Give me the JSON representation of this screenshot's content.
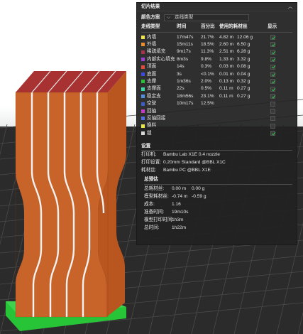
{
  "panel": {
    "title": "切片结果",
    "collapse_icon": "chevron-up-icon",
    "color_scheme": {
      "label": "颜色方案",
      "value": "走线类型"
    },
    "columns": {
      "type": "走线类型",
      "time": "时间",
      "percent": "百分比",
      "filament": "使用的耗材丝",
      "display": "显示"
    },
    "rows": [
      {
        "name": "内墙",
        "color": "#f0e548",
        "time": "17m47s",
        "percent": "21.7%",
        "length": "4.82 m",
        "weight": "12.06 g",
        "shown": true
      },
      {
        "name": "外墙",
        "color": "#f08b2c",
        "time": "15m11s",
        "percent": "18.5%",
        "length": "2.60 m",
        "weight": "6.50 g",
        "shown": true
      },
      {
        "name": "稀疏填充",
        "color": "#a8324a",
        "time": "9m17s",
        "percent": "11.3%",
        "length": "2.51 m",
        "weight": "6.28 g",
        "shown": true
      },
      {
        "name": "内部实心填充",
        "color": "#9b3fd6",
        "time": "8m3s",
        "percent": "9.8%",
        "length": "1.33 m",
        "weight": "3.32 g",
        "shown": true
      },
      {
        "name": "顶面",
        "color": "#e24a3a",
        "time": "14s",
        "percent": "0.3%",
        "length": "0.03 m",
        "weight": "0.08 g",
        "shown": true
      },
      {
        "name": "底面",
        "color": "#3c4ae0",
        "time": "3s",
        "percent": "<0.1%",
        "length": "0.01 m",
        "weight": "0.04 g",
        "shown": true
      },
      {
        "name": "支撑",
        "color": "#27c437",
        "time": "1m36s",
        "percent": "2.0%",
        "length": "0.13 m",
        "weight": "0.32 g",
        "shown": true
      },
      {
        "name": "支撑面",
        "color": "#3cd9a6",
        "time": "22s",
        "percent": "0.5%",
        "length": "0.11 m",
        "weight": "0.27 g",
        "shown": true
      },
      {
        "name": "稳定支",
        "color": "#4f8fe0",
        "time": "18m56s",
        "percent": "23.1%",
        "length": "0.11 m",
        "weight": "0.27 g",
        "shown": true
      },
      {
        "name": "空驶",
        "color": "#3b5fc4",
        "time": "10m17s",
        "percent": "12.5%",
        "length": "",
        "weight": "",
        "shown": false
      },
      {
        "name": "回抽",
        "color": "#c43cc4",
        "time": "",
        "percent": "",
        "length": "",
        "weight": "",
        "shown": false
      },
      {
        "name": "反抽回接",
        "color": "#4f6fe0",
        "time": "",
        "percent": "",
        "length": "",
        "weight": "",
        "shown": false
      },
      {
        "name": "换料",
        "color": "#e8e84a",
        "time": "",
        "percent": "",
        "length": "",
        "weight": "",
        "shown": false
      },
      {
        "name": "缝",
        "color": "#d8d8d8",
        "time": "",
        "percent": "",
        "length": "",
        "weight": "",
        "shown": true
      }
    ],
    "settings": {
      "title": "设置",
      "printer": {
        "label": "打印机:",
        "value": "Bambu Lab X1E 0.4 nozzle"
      },
      "process": {
        "label": "打印设置:",
        "value": "0.20mm Standard @BBL X1C"
      },
      "filament": {
        "label": "耗材丝:",
        "value": "Bambu PC @BBL X1E"
      }
    },
    "summary": {
      "title": "总预估",
      "total_filament": {
        "label": "总耗材丝:",
        "value": "0.00 m",
        "value2": "0.00 g"
      },
      "model_filament": {
        "label": "模型耗材丝:",
        "value": "-0.74 m",
        "value2": "-0.59 g"
      },
      "cost": {
        "label": "成本:",
        "value": "1.16"
      },
      "prep_time": {
        "label": "准备时间:",
        "value": "19m10s"
      },
      "model_time": {
        "label": "模型打印时间:",
        "value": "1h3m"
      },
      "total_time": {
        "label": "总时间:",
        "value": "1h22m"
      }
    }
  },
  "viewport": {
    "plate_color": "#2b2b2b",
    "grid_color": "#4a4a4a",
    "model_color": "#c8642a",
    "model_top_color": "#a83232",
    "support_color": "#27c437"
  }
}
